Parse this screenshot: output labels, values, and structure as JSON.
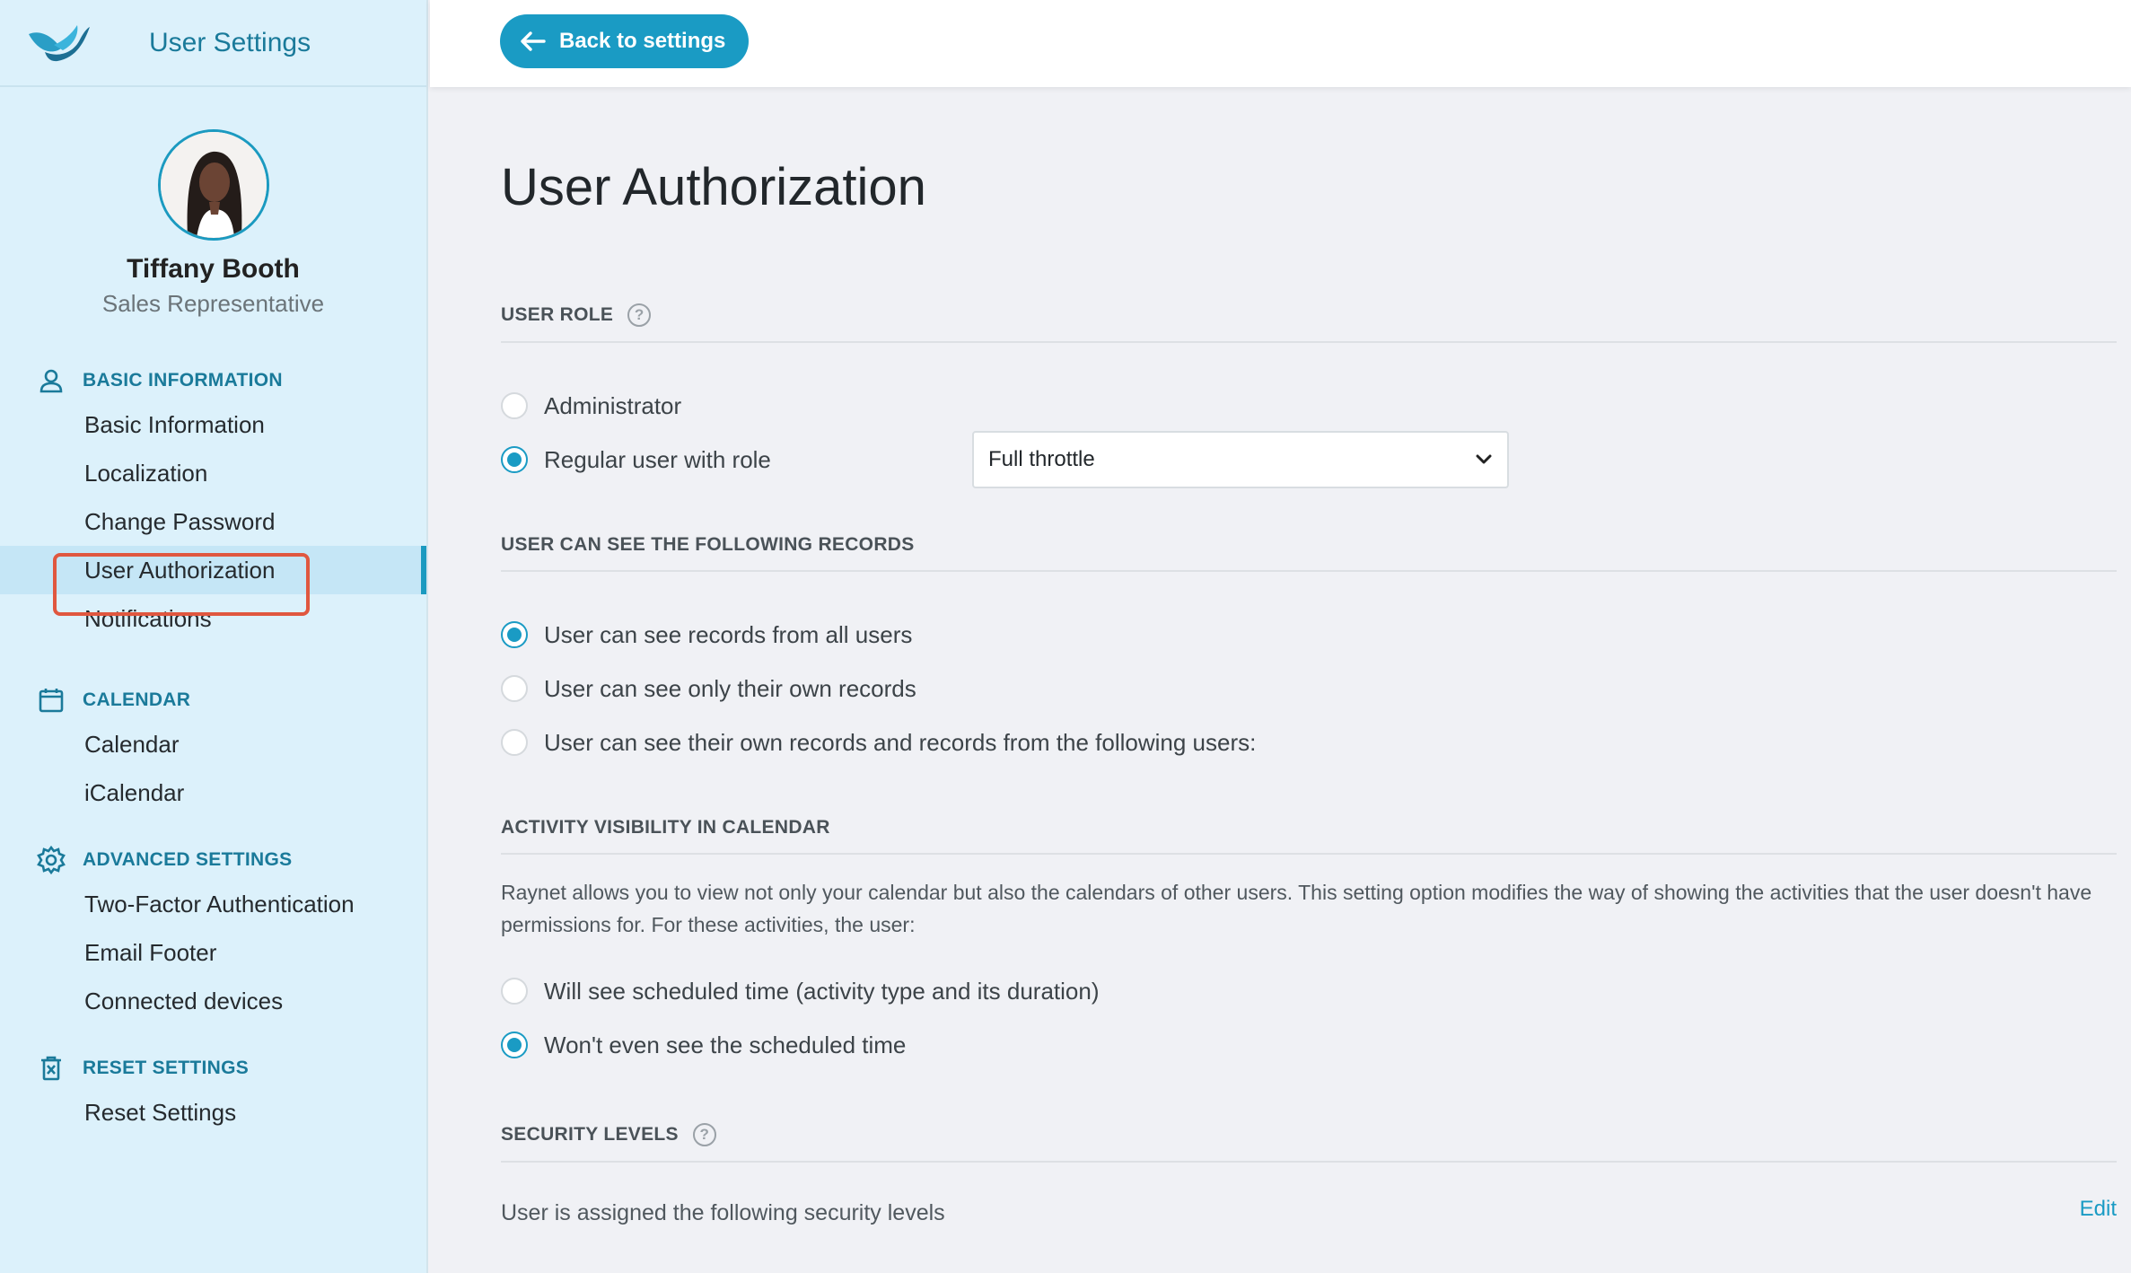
{
  "app": {
    "title": "User Settings"
  },
  "profile": {
    "name": "Tiffany Booth",
    "role": "Sales Representative"
  },
  "sidebar": {
    "sections": [
      {
        "label": "BASIC INFORMATION",
        "icon": "user-icon",
        "items": [
          "Basic Information",
          "Localization",
          "Change Password",
          "User Authorization",
          "Notifications"
        ]
      },
      {
        "label": "CALENDAR",
        "icon": "calendar-icon",
        "items": [
          "Calendar",
          "iCalendar"
        ]
      },
      {
        "label": "ADVANCED SETTINGS",
        "icon": "gear-icon",
        "items": [
          "Two-Factor Authentication",
          "Email Footer",
          "Connected devices"
        ]
      },
      {
        "label": "RESET SETTINGS",
        "icon": "trash-icon",
        "items": [
          "Reset Settings"
        ]
      }
    ],
    "active_item": "User Authorization"
  },
  "topbar": {
    "back_label": "Back to settings"
  },
  "main": {
    "title": "User Authorization",
    "user_role": {
      "heading": "USER ROLE",
      "options": [
        "Administrator",
        "Regular user with role"
      ],
      "selected": 1,
      "role_select_value": "Full throttle"
    },
    "records": {
      "heading": "USER CAN SEE THE FOLLOWING RECORDS",
      "options": [
        "User can see records from all users",
        "User can see only their own records",
        "User can see their own records and records from the following users:"
      ],
      "selected": 0
    },
    "activity": {
      "heading": "ACTIVITY VISIBILITY IN CALENDAR",
      "description": "Raynet allows you to view not only your calendar but also the calendars of other users. This setting option modifies the way of showing the activities that the user doesn't have permissions for. For these activities, the user:",
      "options": [
        "Will see scheduled time (activity type and its duration)",
        "Won't even see the scheduled time"
      ],
      "selected": 1
    },
    "security": {
      "heading": "SECURITY LEVELS",
      "text": "User is assigned the following security levels",
      "edit_label": "Edit"
    }
  },
  "colors": {
    "accent": "#1a9bc4",
    "sidebar_bg": "#dcf1fb",
    "highlight": "#e0573f"
  }
}
